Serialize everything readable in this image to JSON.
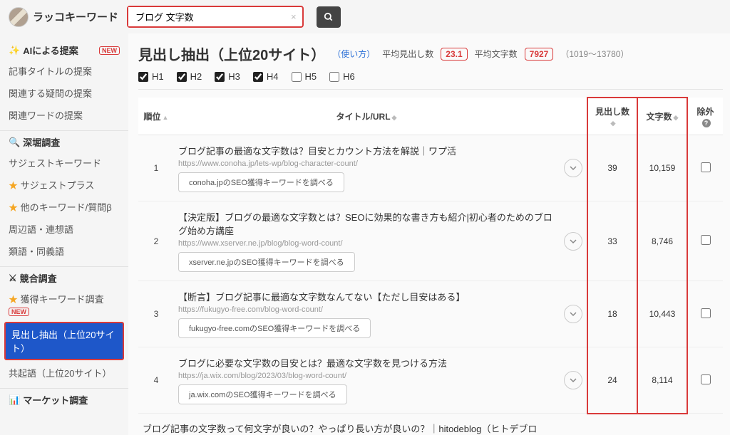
{
  "brand": "ラッコキーワード",
  "search": {
    "value": "ブログ 文字数"
  },
  "sidebar": {
    "sections": [
      {
        "title": "AIによる提案",
        "icon": "✨",
        "badge": "NEW",
        "items": [
          {
            "label": "記事タイトルの提案"
          },
          {
            "label": "関連する疑問の提案"
          },
          {
            "label": "関連ワードの提案"
          }
        ]
      },
      {
        "title": "深堀調査",
        "icon": "🔍",
        "items": [
          {
            "label": "サジェストキーワード"
          },
          {
            "label": "サジェストプラス",
            "star": true
          },
          {
            "label": "他のキーワード/質問β",
            "star": true
          },
          {
            "label": "周辺語・連想語"
          },
          {
            "label": "類語・同義語"
          }
        ]
      },
      {
        "title": "競合調査",
        "icon": "⚔",
        "items": [
          {
            "label": "獲得キーワード調査",
            "star": true,
            "badge": "NEW"
          },
          {
            "label": "見出し抽出（上位20サイト）",
            "active": true
          },
          {
            "label": "共起語（上位20サイト）"
          }
        ]
      },
      {
        "title": "マーケット調査",
        "icon": "📊",
        "items": []
      }
    ]
  },
  "page": {
    "title": "見出し抽出（上位20サイト）",
    "usage": "（使い方）",
    "avg_head_label": "平均見出し数",
    "avg_head_val": "23.1",
    "avg_char_label": "平均文字数",
    "avg_char_val": "7927",
    "range": "（1019～13780）"
  },
  "filters": [
    {
      "label": "H1",
      "checked": true
    },
    {
      "label": "H2",
      "checked": true
    },
    {
      "label": "H3",
      "checked": true
    },
    {
      "label": "H4",
      "checked": true
    },
    {
      "label": "H5",
      "checked": false
    },
    {
      "label": "H6",
      "checked": false
    }
  ],
  "columns": {
    "rank": "順位",
    "title": "タイトル/URL",
    "headings": "見出し数",
    "chars": "文字数",
    "exclude": "除外"
  },
  "rows": [
    {
      "rank": 1,
      "title": "ブログ記事の最適な文字数は？目安とカウント方法を解説｜ワプ活",
      "url": "https://www.conoha.jp/lets-wp/blog-character-count/",
      "kw_btn": "conoha.jpのSEO獲得キーワードを調べる",
      "headings": 39,
      "chars": "10,159"
    },
    {
      "rank": 2,
      "title": "【決定版】ブログの最適な文字数とは？SEOに効果的な書き方も紹介|初心者のためのブログ始め方講座",
      "url": "https://www.xserver.ne.jp/blog/blog-word-count/",
      "kw_btn": "xserver.ne.jpのSEO獲得キーワードを調べる",
      "headings": 33,
      "chars": "8,746"
    },
    {
      "rank": 3,
      "title": "【断言】ブログ記事に最適な文字数なんてない【ただし目安はある】",
      "url": "https://fukugyo-free.com/blog-word-count/",
      "kw_btn": "fukugyo-free.comのSEO獲得キーワードを調べる",
      "headings": 18,
      "chars": "10,443"
    },
    {
      "rank": 4,
      "title": "ブログに必要な文字数の目安とは？最適な文字数を見つける方法",
      "url": "https://ja.wix.com/blog/2023/03/blog-word-count/",
      "kw_btn": "ja.wix.comのSEO獲得キーワードを調べる",
      "headings": 24,
      "chars": "8,114"
    }
  ],
  "cutoff": "ブログ記事の文字数って何文字が良いの？やっぱり長い方が良いの？｜hitodeblog（ヒトデブロ"
}
